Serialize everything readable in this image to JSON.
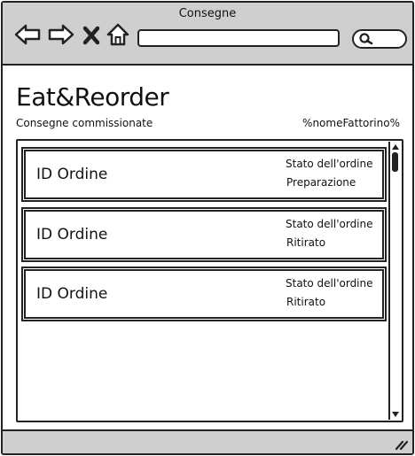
{
  "window": {
    "title": "Consegne"
  },
  "toolbar": {
    "back_icon": "arrow-left-icon",
    "forward_icon": "arrow-right-icon",
    "stop_icon": "close-icon",
    "home_icon": "home-icon",
    "search_icon": "search-icon",
    "url_value": ""
  },
  "header": {
    "app_title": "Eat&Reorder",
    "subtitle": "Consegne commissionate",
    "courier": "%nomeFattorino%"
  },
  "orders": [
    {
      "id_label": "ID Ordine",
      "status_label": "Stato dell'ordine",
      "status_value": "Preparazione"
    },
    {
      "id_label": "ID Ordine",
      "status_label": "Stato dell'ordine",
      "status_value": "Ritirato"
    },
    {
      "id_label": "ID Ordine",
      "status_label": "Stato dell'ordine",
      "status_value": "Ritirato"
    }
  ],
  "colors": {
    "chrome": "#cfcfcf",
    "stroke": "#222222",
    "background": "#ffffff"
  }
}
